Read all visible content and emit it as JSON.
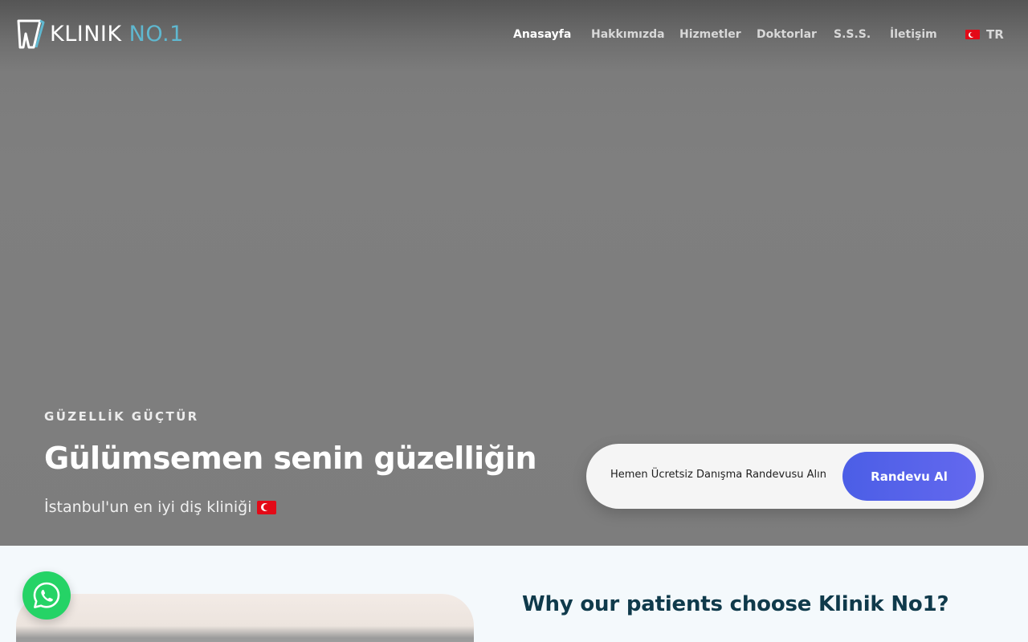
{
  "brand": {
    "logo_part1": "KLINIK",
    "logo_part2": "NO.1",
    "accent_color": "#5fb8d0"
  },
  "nav": {
    "items": [
      {
        "label": "Anasayfa",
        "active": true
      },
      {
        "label": "Hakkımızda",
        "active": false
      },
      {
        "label": "Hizmetler",
        "active": false
      },
      {
        "label": "Doktorlar",
        "active": false
      },
      {
        "label": "S.S.S.",
        "active": false
      },
      {
        "label": "İletişim",
        "active": false
      }
    ],
    "language": "TR"
  },
  "hero": {
    "eyebrow": "GÜZELLİK GÜÇTÜR",
    "headline": "Gülümsemen senin güzelliğin",
    "subtitle": "İstanbul'un en iyi diş kliniği"
  },
  "cta": {
    "text": "Hemen Ücretsiz Danışma Randevusu Alın",
    "button_label": "Randevu Al",
    "button_color": "#4b5ee6"
  },
  "section": {
    "title": "Why our patients choose Klinik No1?"
  },
  "icons": {
    "logo": "tooth-logo-icon",
    "flag": "turkey-flag-icon",
    "chat": "whatsapp-icon"
  }
}
